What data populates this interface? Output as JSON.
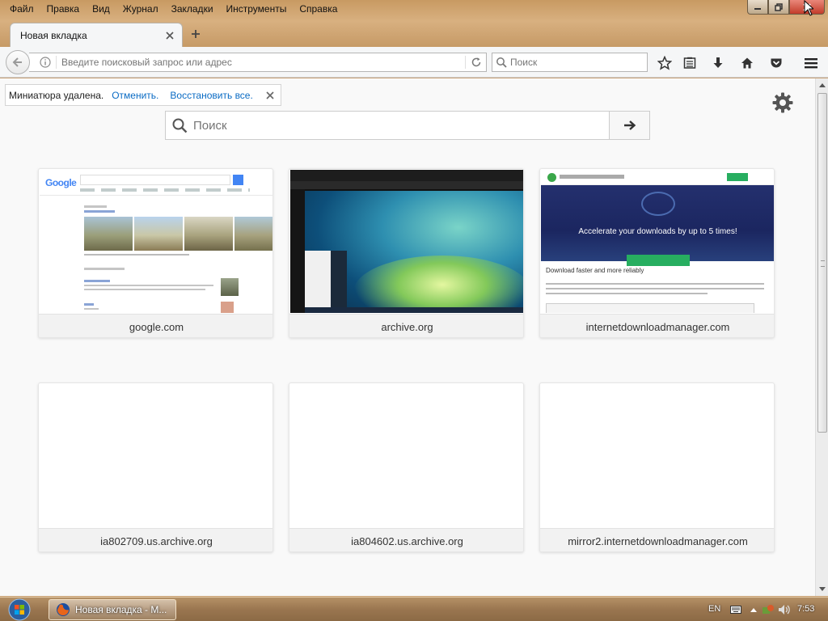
{
  "menu": [
    "Файл",
    "Правка",
    "Вид",
    "Журнал",
    "Закладки",
    "Инструменты",
    "Справка"
  ],
  "tab": {
    "title": "Новая вкладка"
  },
  "urlbar": {
    "placeholder": "Введите поисковый запрос или адрес"
  },
  "searchbar": {
    "placeholder": "Поиск"
  },
  "undo": {
    "text": "Миниатюра удалена.",
    "undo_label": "Отменить.",
    "restore_label": "Восстановить все."
  },
  "newtab_search": {
    "placeholder": "Поиск"
  },
  "tiles": [
    {
      "title": "google.com"
    },
    {
      "title": "archive.org"
    },
    {
      "title": "internetdownloadmanager.com"
    },
    {
      "title": "ia802709.us.archive.org"
    },
    {
      "title": "ia804602.us.archive.org"
    },
    {
      "title": "mirror2.internetdownloadmanager.com"
    }
  ],
  "thumb_text": {
    "google_logo": "Google",
    "idm_headline": "Accelerate your downloads by up to 5 times!",
    "idm_sub": "Download faster and more reliably"
  },
  "taskbar": {
    "task_label": "Новая вкладка - M...",
    "lang": "EN",
    "clock": "7:53"
  },
  "colors": {
    "accent_link": "#0a6bc4",
    "chrome_bg": "#f5f6f7",
    "taskbar": "#9a7650"
  }
}
